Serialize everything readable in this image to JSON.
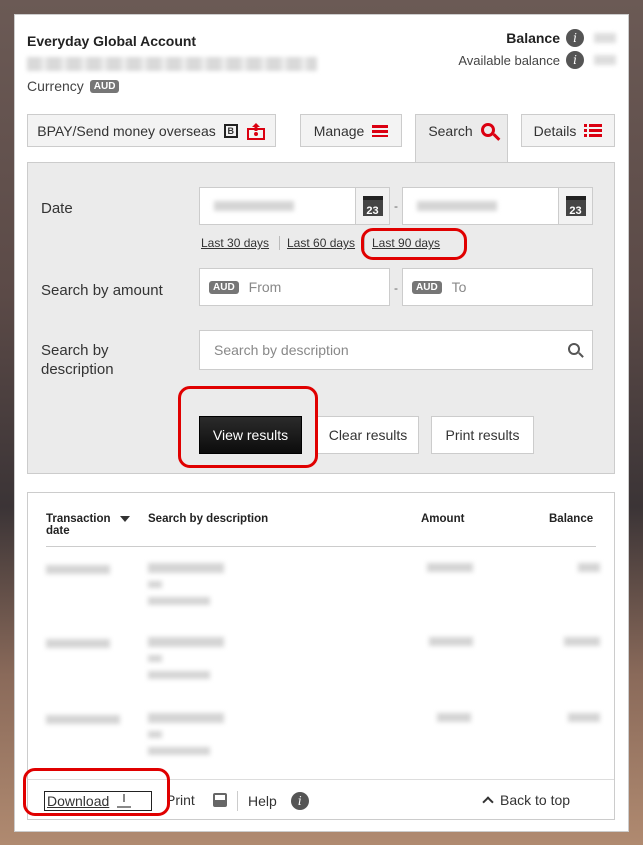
{
  "account": {
    "title": "Everyday Global Account",
    "currency_label": "Currency",
    "currency_code": "AUD",
    "balance_label": "Balance",
    "available_label": "Available balance"
  },
  "tabs": {
    "bpay": "BPAY/Send money overseas",
    "manage": "Manage",
    "search": "Search",
    "details": "Details"
  },
  "search": {
    "date_label": "Date",
    "calendar_day": "23",
    "quick_links": [
      "Last 30 days",
      "Last 60 days",
      "Last 90 days"
    ],
    "amount_label": "Search by amount",
    "amount_currency": "AUD",
    "from_placeholder": "From",
    "to_placeholder": "To",
    "desc_label": "Search by description",
    "desc_placeholder": "Search by description",
    "view_results": "View results",
    "clear_results": "Clear results",
    "print_results": "Print results"
  },
  "table": {
    "headers": [
      "Transaction date",
      "Search by description",
      "Amount",
      "Balance"
    ]
  },
  "footer": {
    "download": "Download",
    "print": "Print",
    "help": "Help",
    "back_to_top": "Back to top"
  },
  "colors": {
    "accent_red": "#db0011",
    "annotation_red": "#e00000",
    "panel_bg": "#ebebeb"
  }
}
